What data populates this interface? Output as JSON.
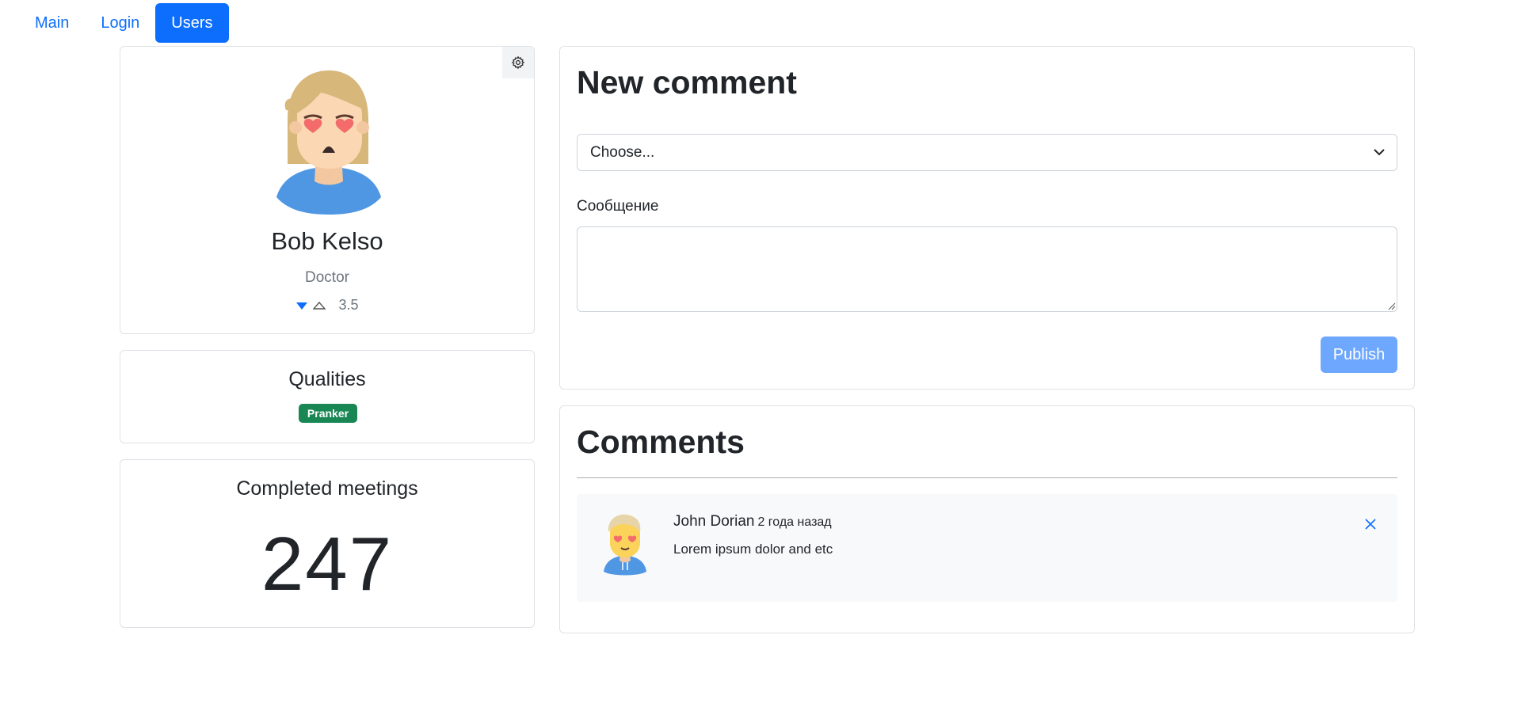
{
  "nav": {
    "items": [
      {
        "label": "Main",
        "active": false
      },
      {
        "label": "Login",
        "active": false
      },
      {
        "label": "Users",
        "active": true
      }
    ]
  },
  "profile": {
    "name": "Bob Kelso",
    "profession": "Doctor",
    "rate": "3.5",
    "settings_icon": "gear-icon",
    "vote_down_icon": "caret-down-filled-icon",
    "vote_up_icon": "caret-up-outline-icon"
  },
  "qualities": {
    "title": "Qualities",
    "badges": [
      {
        "label": "Pranker",
        "color": "#198754"
      }
    ]
  },
  "meetings": {
    "title": "Completed meetings",
    "value": "247"
  },
  "new_comment": {
    "title": "New comment",
    "select_value": "Choose...",
    "message_label": "Сообщение",
    "message_value": "",
    "publish_label": "Publish"
  },
  "comments": {
    "title": "Comments",
    "items": [
      {
        "author": "John Dorian",
        "time": "2 года назад",
        "text": "Lorem ipsum dolor and etc",
        "delete_icon": "close-icon"
      }
    ]
  },
  "colors": {
    "primary": "#0d6efd",
    "publish_disabled": "#6ea8fe",
    "success_badge": "#198754",
    "comment_bg": "#f8f9fa"
  }
}
